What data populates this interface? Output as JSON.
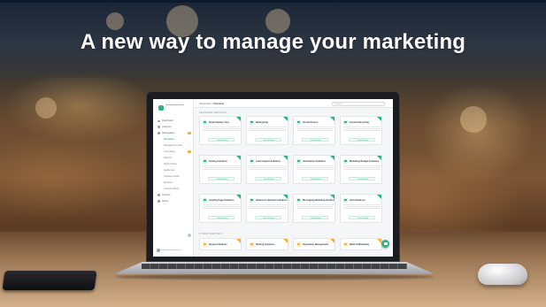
{
  "headline": "A new way to manage your marketing",
  "app": {
    "logo_text": "marketing dashboard",
    "breadcrumb_root": "Marketplace",
    "breadcrumb_current": "Overview",
    "search_placeholder": "Search",
    "sidebar": {
      "items": [
        {
          "label": "Dashboard",
          "icon": "home-icon",
          "sub": false,
          "active": false,
          "badge": false
        },
        {
          "label": "Analytics",
          "icon": "chart-icon",
          "sub": false,
          "active": false,
          "badge": false
        },
        {
          "label": "Marketplace",
          "icon": "grid-icon",
          "sub": false,
          "active": false,
          "badge": true
        },
        {
          "label": "Overview",
          "icon": "",
          "sub": true,
          "active": true,
          "badge": false
        },
        {
          "label": "Managed Services",
          "icon": "",
          "sub": true,
          "active": false,
          "badge": false
        },
        {
          "label": "Consulting",
          "icon": "",
          "sub": true,
          "active": false,
          "badge": true
        },
        {
          "label": "Reports",
          "icon": "",
          "sub": true,
          "active": false,
          "badge": false
        },
        {
          "label": "Partnerships",
          "icon": "",
          "sub": true,
          "active": false,
          "badge": false
        },
        {
          "label": "Audiences",
          "icon": "",
          "sub": true,
          "active": false,
          "badge": false
        },
        {
          "label": "Creative Studio",
          "icon": "",
          "sub": true,
          "active": false,
          "badge": false
        },
        {
          "label": "Reviews",
          "icon": "",
          "sub": true,
          "active": false,
          "badge": false
        },
        {
          "label": "Content Library",
          "icon": "",
          "sub": true,
          "active": false,
          "badge": false
        },
        {
          "label": "Account",
          "icon": "user-icon",
          "sub": false,
          "active": false,
          "badge": false
        },
        {
          "label": "Admin",
          "icon": "gear-icon",
          "sub": false,
          "active": false,
          "badge": false
        }
      ],
      "footer_user": "admin@marketing.com"
    },
    "featured_title": "FEATURED SERVICES",
    "featured_cards": [
      {
        "title": "Email Capture Tool",
        "button": "View Solution",
        "color": "green"
      },
      {
        "title": "Retargeting",
        "button": "View Solution",
        "color": "green"
      },
      {
        "title": "Social Posters",
        "button": "View Solution",
        "color": "green"
      },
      {
        "title": "Content Recycling",
        "button": "View Solution",
        "color": "green"
      },
      {
        "title": "Testing Solutions",
        "button": "View Solution",
        "color": "green"
      },
      {
        "title": "Lead Capture Solutions",
        "button": "View Solution",
        "color": "green"
      },
      {
        "title": "Automation Solutions",
        "button": "View Solution",
        "color": "green"
      },
      {
        "title": "Marketing Budget Solutions",
        "button": "View Solution",
        "color": "green"
      },
      {
        "title": "Landing Page Solutions",
        "button": "View Solution",
        "color": "green"
      },
      {
        "title": "Influencer Outreach Solutions",
        "button": "View Solution",
        "color": "green"
      },
      {
        "title": "Messaging Marketing Solutions",
        "button": "View Solution",
        "color": "green"
      },
      {
        "title": "Chat Solutions",
        "button": "View Solution",
        "color": "green"
      }
    ],
    "other_title": "OTHER SERVICES",
    "other_cards": [
      {
        "title": "Review Solutions",
        "color": "orange"
      },
      {
        "title": "Sharing Solutions",
        "color": "orange"
      },
      {
        "title": "Reputation Management",
        "color": "orange"
      },
      {
        "title": "Referral Marketing",
        "color": "orange"
      }
    ]
  }
}
